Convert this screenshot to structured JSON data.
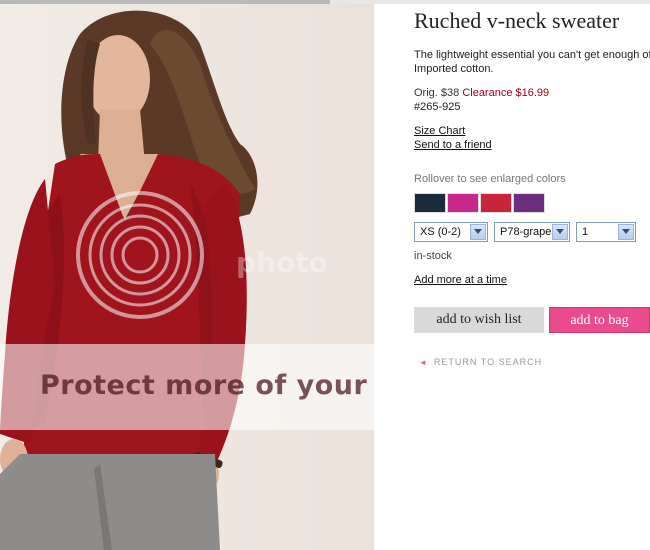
{
  "product": {
    "title": "Ruched v-neck sweater",
    "description": "The lightweight essential you can't get enough of. Imported cotton.",
    "orig_price": "Orig. $38",
    "clearance_price": "Clearance $16.99",
    "item_number": "#265-925",
    "photo_watermark": "Protect more of your memories",
    "photo_watermark_logo": "photo"
  },
  "links": {
    "size_chart": "Size Chart",
    "send_to_friend": "Send to a friend",
    "add_more": "Add more at a time",
    "return_to_search": "RETURN TO SEARCH"
  },
  "colors": {
    "label": "Rollover to see enlarged colors",
    "swatches": [
      "#1b2a3c",
      "#c8288a",
      "#c8243a",
      "#6b2d7e"
    ]
  },
  "selectors": {
    "size": "XS (0-2)",
    "color": "P78-grape",
    "quantity": "1"
  },
  "stock_status": "in-stock",
  "buttons": {
    "wish_list": "add to wish list",
    "add_to_bag": "add to bag"
  }
}
